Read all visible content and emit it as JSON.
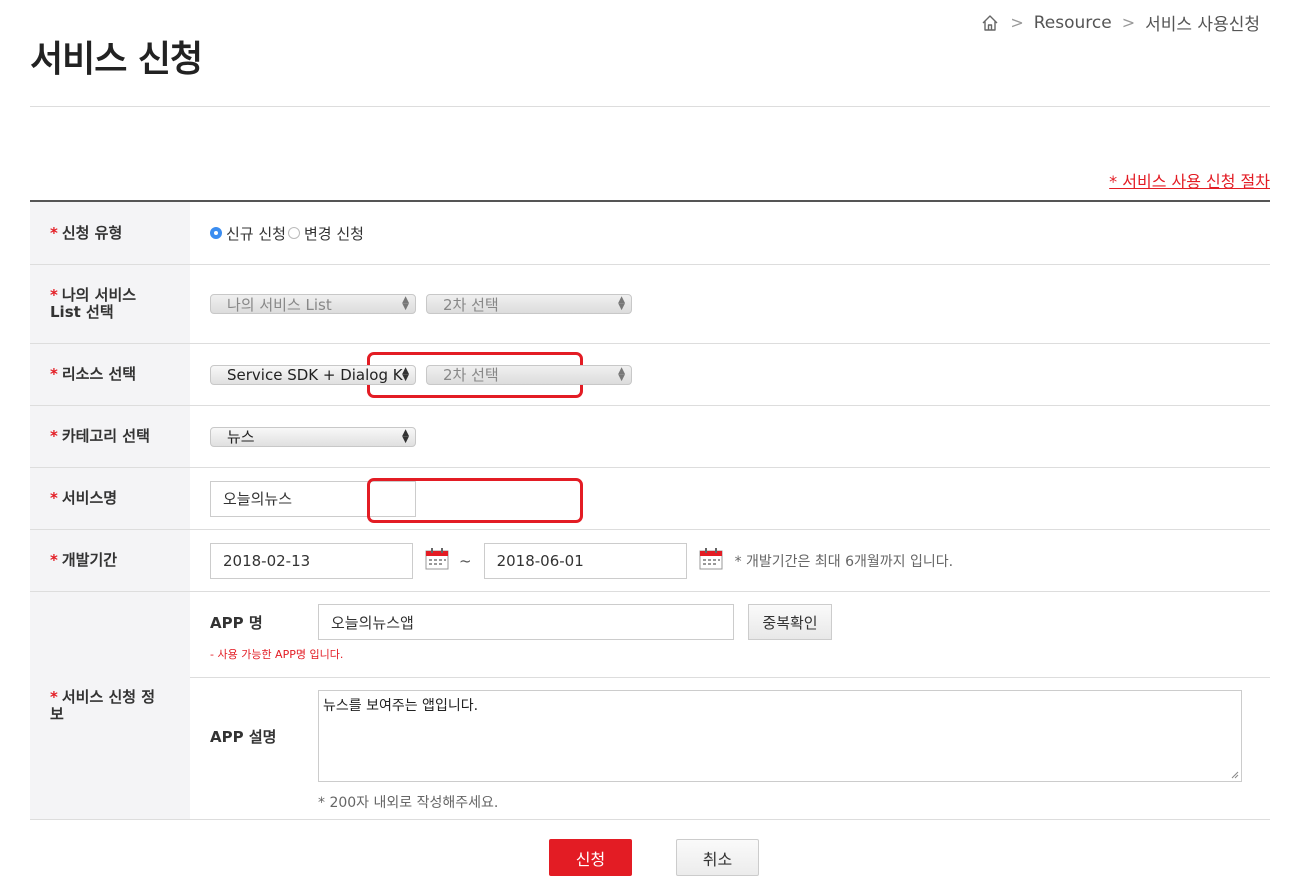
{
  "header": {
    "title": "서비스 신청",
    "breadcrumb": [
      "Resource",
      "서비스 사용신청"
    ]
  },
  "procedure_link": "* 서비스 사용 신청 절차",
  "form": {
    "apply_type": {
      "label": "신청 유형",
      "required_mark": "*",
      "options": [
        {
          "label": "신규 신청",
          "checked": true
        },
        {
          "label": "변경 신청",
          "checked": false
        }
      ]
    },
    "my_service": {
      "label_line1": "나의 서비스",
      "label_line2": "List 선택",
      "required_mark": "*",
      "select1": "나의 서비스 List",
      "select2": "2차 선택"
    },
    "resource": {
      "label": "리소스 선택",
      "required_mark": "*",
      "select1": "Service SDK + Dialog K",
      "select2": "2차 선택"
    },
    "category": {
      "label": "카테고리 선택",
      "required_mark": "*",
      "select1": "뉴스"
    },
    "service_name": {
      "label": "서비스명",
      "required_mark": "*",
      "value": "오늘의뉴스"
    },
    "dev_period": {
      "label": "개발기간",
      "required_mark": "*",
      "start": "2018-02-13",
      "tilde": "~",
      "end": "2018-06-01",
      "note": "* 개발기간은 최대 6개월까지 입니다."
    },
    "service_info": {
      "label": "서비스 신청 정보",
      "required_mark": "*",
      "app_name_label": "APP 명",
      "app_name_value": "오늘의뉴스앱",
      "dup_check_button": "중복확인",
      "app_name_note": "- 사용 가능한 APP명 입니다.",
      "app_desc_label": "APP 설명",
      "app_desc_value": "뉴스를 보여주는 앱입니다.",
      "app_desc_note": "* 200자 내외로 작성해주세요."
    }
  },
  "buttons": {
    "submit": "신청",
    "cancel": "취소"
  },
  "colors": {
    "accent": "#e31c24",
    "radio_checked": "#3b8df0",
    "label_bg": "#f4f4f6"
  }
}
